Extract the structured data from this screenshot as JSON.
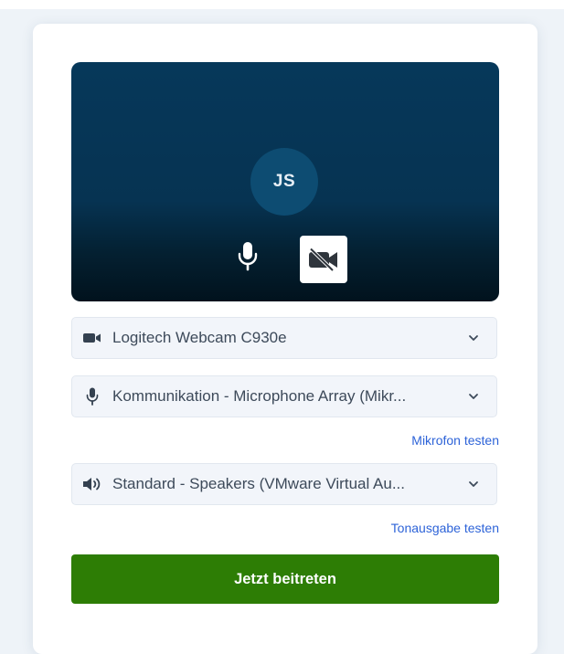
{
  "preview": {
    "avatar_initials": "JS",
    "mic_icon": "microphone-icon",
    "camera_icon": "video-off-icon"
  },
  "devices": {
    "camera": {
      "icon": "video-camera-icon",
      "value": "Logitech Webcam C930e"
    },
    "microphone": {
      "icon": "microphone-icon",
      "value": "Kommunikation - Microphone Array (Mikr..."
    },
    "speaker": {
      "icon": "speaker-icon",
      "value": "Standard - Speakers (VMware Virtual Au..."
    }
  },
  "links": {
    "test_microphone": "Mikrofon testen",
    "test_speaker": "Tonausgabe testen"
  },
  "join_button": "Jetzt beitreten",
  "colors": {
    "preview_bg": "#06385a",
    "avatar_bg": "#0d4c72",
    "link": "#2d63d8",
    "join_bg": "#2d7d05"
  }
}
